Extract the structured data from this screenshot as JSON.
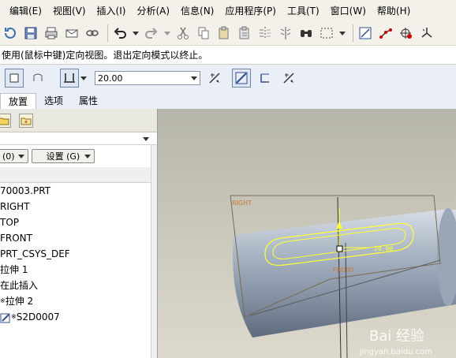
{
  "menu": {
    "items": [
      "编辑(E)",
      "视图(V)",
      "插入(I)",
      "分析(A)",
      "信息(N)",
      "应用程序(P)",
      "工具(T)",
      "窗口(W)",
      "帮助(H)"
    ]
  },
  "message_line": "使用(鼠标中键)定向视图。退出定向模式以终止。",
  "dashboard": {
    "depth_value": "20.00"
  },
  "tabs": [
    "放置",
    "选项",
    "属性"
  ],
  "nav_panel": {
    "tab_icons": [
      "folder-icon",
      "star-folder-icon"
    ],
    "buttons": {
      "show_label": "(0)",
      "settings_label": "设置 (G)"
    },
    "tree": [
      "70003.PRT",
      "RIGHT",
      "TOP",
      "FRONT",
      "PRT_CSYS_DEF",
      "拉伸 1",
      "在此插入",
      "拉伸 2",
      "S2D0007"
    ]
  },
  "viewport": {
    "datum_labels": {
      "right": "RIGHT",
      "front": "FRONT"
    },
    "dimension_text": "20.00",
    "sketch_color": "#ffff33",
    "datum_color": "#c8782d"
  },
  "watermark": {
    "text": "Bai 经验",
    "sub": "jingyan.baidu.com"
  }
}
